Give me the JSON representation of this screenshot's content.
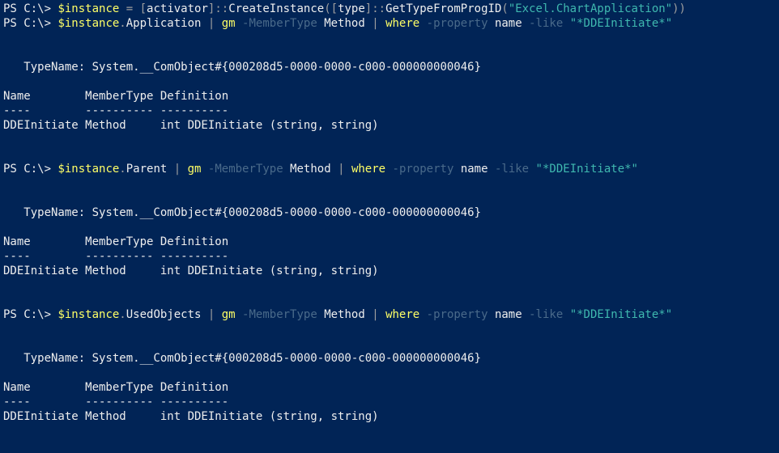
{
  "lines": [
    {
      "segments": [
        {
          "cls": "prompt",
          "text": "PS C:\\> "
        },
        {
          "cls": "cmd",
          "text": "$instance "
        },
        {
          "cls": "op",
          "text": "= ["
        },
        {
          "cls": "text",
          "text": "activator"
        },
        {
          "cls": "op",
          "text": "]::"
        },
        {
          "cls": "text",
          "text": "CreateInstance"
        },
        {
          "cls": "op",
          "text": "(["
        },
        {
          "cls": "text",
          "text": "type"
        },
        {
          "cls": "op",
          "text": "]::"
        },
        {
          "cls": "text",
          "text": "GetTypeFromProgID"
        },
        {
          "cls": "op",
          "text": "("
        },
        {
          "cls": "str",
          "text": "\"Excel.ChartApplication\""
        },
        {
          "cls": "op",
          "text": "))"
        }
      ]
    },
    {
      "segments": [
        {
          "cls": "prompt",
          "text": "PS C:\\> "
        },
        {
          "cls": "cmd",
          "text": "$instance"
        },
        {
          "cls": "op",
          "text": "."
        },
        {
          "cls": "text",
          "text": "Application "
        },
        {
          "cls": "op",
          "text": "| "
        },
        {
          "cls": "cmd",
          "text": "gm "
        },
        {
          "cls": "darkop",
          "text": "-MemberType "
        },
        {
          "cls": "text",
          "text": "Method "
        },
        {
          "cls": "op",
          "text": "| "
        },
        {
          "cls": "cmd",
          "text": "where "
        },
        {
          "cls": "darkop",
          "text": "-property "
        },
        {
          "cls": "text",
          "text": "name "
        },
        {
          "cls": "darkop",
          "text": "-like "
        },
        {
          "cls": "str",
          "text": "\"*DDEInitiate*\""
        }
      ]
    },
    {
      "blank": true
    },
    {
      "blank": true
    },
    {
      "segments": [
        {
          "cls": "text",
          "text": "   TypeName: System.__ComObject#{000208d5-0000-0000-c000-000000000046}"
        }
      ]
    },
    {
      "blank": true
    },
    {
      "segments": [
        {
          "cls": "text",
          "text": "Name        MemberType Definition"
        }
      ]
    },
    {
      "segments": [
        {
          "cls": "text",
          "text": "----        ---------- ----------"
        }
      ]
    },
    {
      "segments": [
        {
          "cls": "text",
          "text": "DDEInitiate Method     int DDEInitiate (string, string)"
        }
      ]
    },
    {
      "blank": true
    },
    {
      "blank": true
    },
    {
      "segments": [
        {
          "cls": "prompt",
          "text": "PS C:\\> "
        },
        {
          "cls": "cmd",
          "text": "$instance"
        },
        {
          "cls": "op",
          "text": "."
        },
        {
          "cls": "text",
          "text": "Parent "
        },
        {
          "cls": "op",
          "text": "| "
        },
        {
          "cls": "cmd",
          "text": "gm "
        },
        {
          "cls": "darkop",
          "text": "-MemberType "
        },
        {
          "cls": "text",
          "text": "Method "
        },
        {
          "cls": "op",
          "text": "| "
        },
        {
          "cls": "cmd",
          "text": "where "
        },
        {
          "cls": "darkop",
          "text": "-property "
        },
        {
          "cls": "text",
          "text": "name "
        },
        {
          "cls": "darkop",
          "text": "-like "
        },
        {
          "cls": "str",
          "text": "\"*DDEInitiate*\""
        }
      ]
    },
    {
      "blank": true
    },
    {
      "blank": true
    },
    {
      "segments": [
        {
          "cls": "text",
          "text": "   TypeName: System.__ComObject#{000208d5-0000-0000-c000-000000000046}"
        }
      ]
    },
    {
      "blank": true
    },
    {
      "segments": [
        {
          "cls": "text",
          "text": "Name        MemberType Definition"
        }
      ]
    },
    {
      "segments": [
        {
          "cls": "text",
          "text": "----        ---------- ----------"
        }
      ]
    },
    {
      "segments": [
        {
          "cls": "text",
          "text": "DDEInitiate Method     int DDEInitiate (string, string)"
        }
      ]
    },
    {
      "blank": true
    },
    {
      "blank": true
    },
    {
      "segments": [
        {
          "cls": "prompt",
          "text": "PS C:\\> "
        },
        {
          "cls": "cmd",
          "text": "$instance"
        },
        {
          "cls": "op",
          "text": "."
        },
        {
          "cls": "text",
          "text": "UsedObjects "
        },
        {
          "cls": "op",
          "text": "| "
        },
        {
          "cls": "cmd",
          "text": "gm "
        },
        {
          "cls": "darkop",
          "text": "-MemberType "
        },
        {
          "cls": "text",
          "text": "Method "
        },
        {
          "cls": "op",
          "text": "| "
        },
        {
          "cls": "cmd",
          "text": "where "
        },
        {
          "cls": "darkop",
          "text": "-property "
        },
        {
          "cls": "text",
          "text": "name "
        },
        {
          "cls": "darkop",
          "text": "-like "
        },
        {
          "cls": "str",
          "text": "\"*DDEInitiate*\""
        }
      ]
    },
    {
      "blank": true
    },
    {
      "blank": true
    },
    {
      "segments": [
        {
          "cls": "text",
          "text": "   TypeName: System.__ComObject#{000208d5-0000-0000-c000-000000000046}"
        }
      ]
    },
    {
      "blank": true
    },
    {
      "segments": [
        {
          "cls": "text",
          "text": "Name        MemberType Definition"
        }
      ]
    },
    {
      "segments": [
        {
          "cls": "text",
          "text": "----        ---------- ----------"
        }
      ]
    },
    {
      "segments": [
        {
          "cls": "text",
          "text": "DDEInitiate Method     int DDEInitiate (string, string)"
        }
      ]
    }
  ]
}
